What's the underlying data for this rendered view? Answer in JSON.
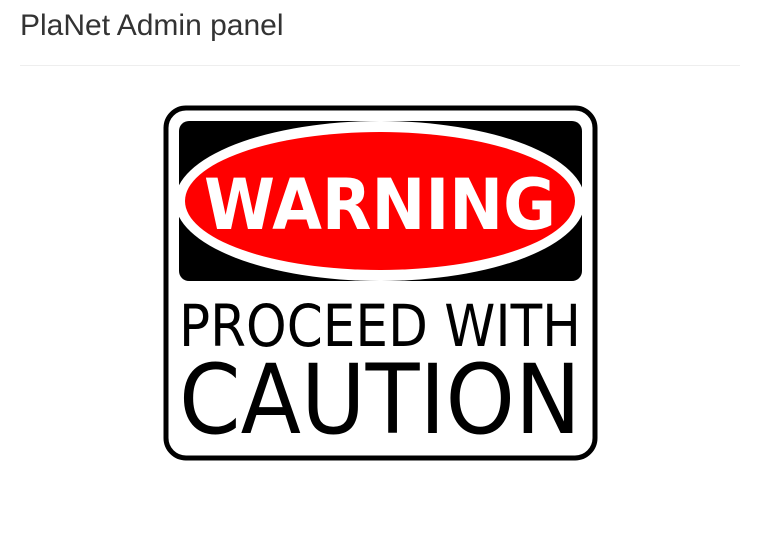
{
  "header": {
    "title": "PlaNet Admin panel"
  },
  "sign": {
    "banner_text": "WARNING",
    "line1": "PROCEED WITH",
    "line2": "CAUTION",
    "colors": {
      "banner_red": "#ff0000",
      "frame_black": "#000000",
      "background_white": "#ffffff"
    }
  }
}
